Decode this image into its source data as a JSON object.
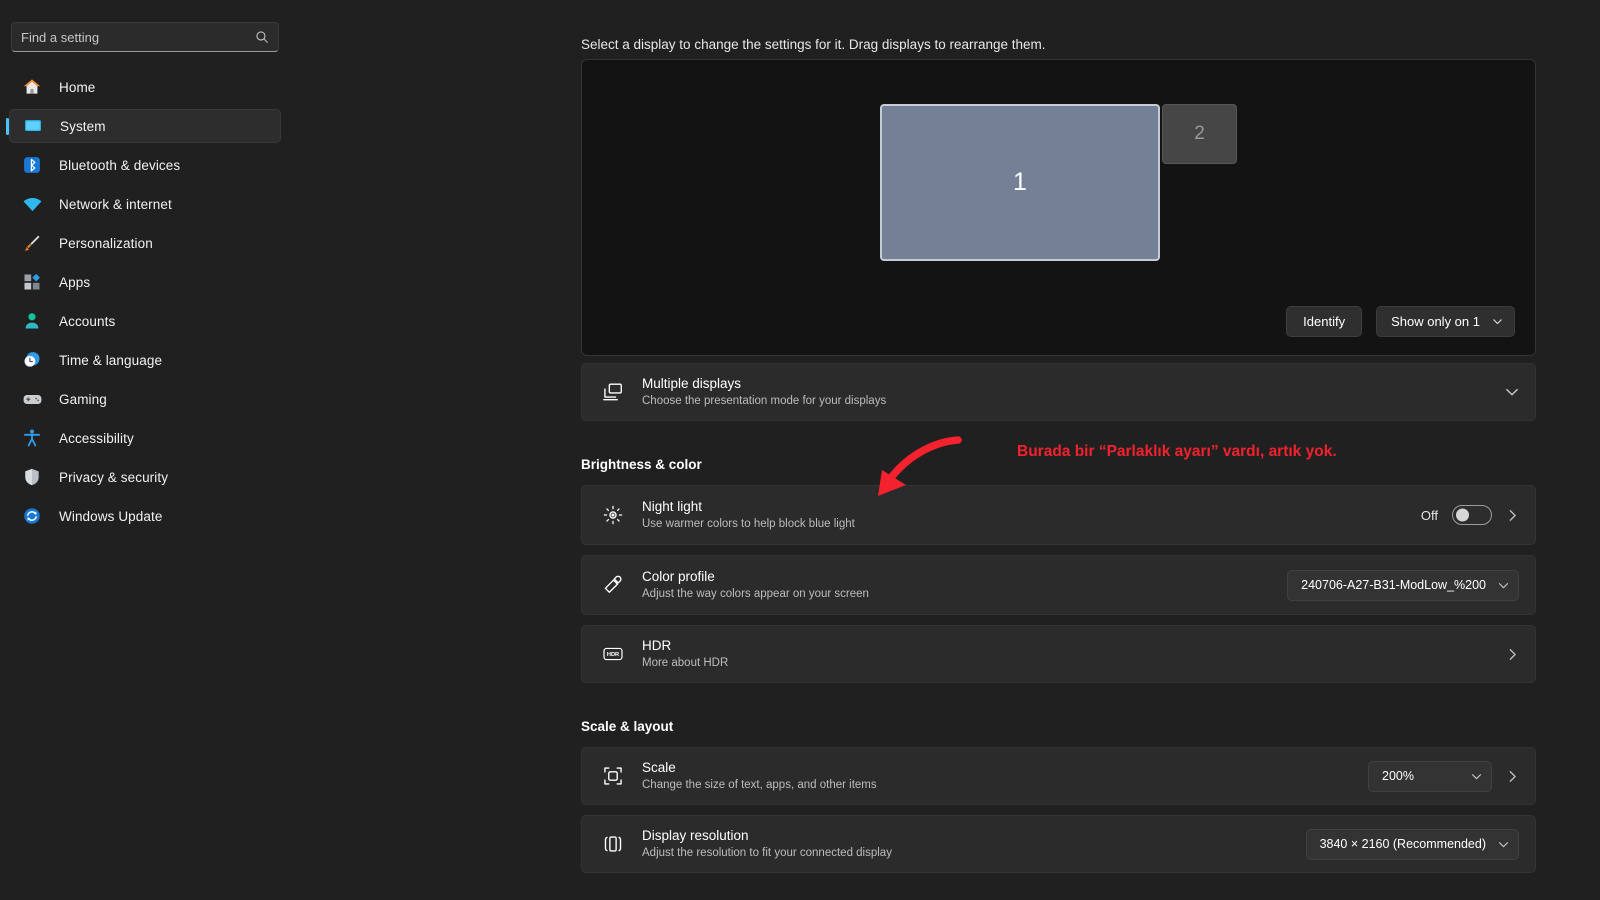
{
  "colors": {
    "accent": "#4cc2ff",
    "annotation_red": "#f4212e",
    "display1_fill": "#748095",
    "display2_fill": "#464646",
    "page_bg": "#202020",
    "card_bg": "#2b2b2b"
  },
  "search": {
    "placeholder": "Find a setting",
    "value": "",
    "icon": "search-icon"
  },
  "sidebar": {
    "items": [
      {
        "label": "Home",
        "icon": "home-icon",
        "active": false
      },
      {
        "label": "System",
        "icon": "system-monitor-icon",
        "active": true
      },
      {
        "label": "Bluetooth & devices",
        "icon": "bluetooth-icon",
        "active": false
      },
      {
        "label": "Network & internet",
        "icon": "wifi-icon",
        "active": false
      },
      {
        "label": "Personalization",
        "icon": "paintbrush-icon",
        "active": false
      },
      {
        "label": "Apps",
        "icon": "apps-grid-icon",
        "active": false
      },
      {
        "label": "Accounts",
        "icon": "person-icon",
        "active": false
      },
      {
        "label": "Time & language",
        "icon": "clock-globe-icon",
        "active": false
      },
      {
        "label": "Gaming",
        "icon": "gamepad-icon",
        "active": false
      },
      {
        "label": "Accessibility",
        "icon": "accessibility-person-icon",
        "active": false
      },
      {
        "label": "Privacy & security",
        "icon": "shield-icon",
        "active": false
      },
      {
        "label": "Windows Update",
        "icon": "update-refresh-icon",
        "active": false
      }
    ]
  },
  "main": {
    "intro_text": "Select a display to change the settings for it. Drag displays to rearrange them.",
    "display_canvas": {
      "displays": [
        {
          "number": "1",
          "selected": true
        },
        {
          "number": "2",
          "selected": false
        }
      ],
      "identify_button": "Identify",
      "mode_select": {
        "value": "Show only on 1",
        "icon": "chevron-down-icon"
      }
    },
    "multiple_displays": {
      "title": "Multiple displays",
      "subtitle": "Choose the presentation mode for your displays",
      "icon": "multiple-displays-icon",
      "expander_icon": "chevron-down-icon"
    },
    "brightness_color": {
      "heading": "Brightness & color",
      "rows": [
        {
          "title": "Night light",
          "subtitle": "Use warmer colors to help block blue light",
          "icon": "night-light-sun-icon",
          "toggle_label": "Off",
          "toggle_state": "off",
          "chevron_icon": "chevron-right-icon"
        },
        {
          "title": "Color profile",
          "subtitle": "Adjust the way colors appear on your screen",
          "icon": "eyedropper-icon",
          "value": "240706-A27-B31-ModLow_%200",
          "value_icon": "chevron-down-icon"
        },
        {
          "title": "HDR",
          "subtitle": "More about HDR",
          "icon": "hdr-badge-icon",
          "chevron_icon": "chevron-right-icon"
        }
      ]
    },
    "scale_layout": {
      "heading": "Scale & layout",
      "rows": [
        {
          "title": "Scale",
          "subtitle": "Change the size of text, apps, and other items",
          "icon": "scale-resize-icon",
          "value": "200%",
          "value_icon": "chevron-down-icon",
          "chevron_icon": "chevron-right-icon"
        },
        {
          "title": "Display resolution",
          "subtitle": "Adjust the resolution to fit your connected display",
          "icon": "display-resolution-icon",
          "value": "3840 × 2160 (Recommended)",
          "value_icon": "chevron-down-icon"
        }
      ]
    }
  },
  "annotation": {
    "text": "Burada bir “Parlaklık ayarı” vardı, artık yok.",
    "arrow_icon": "curved-arrow-down-left-icon"
  }
}
